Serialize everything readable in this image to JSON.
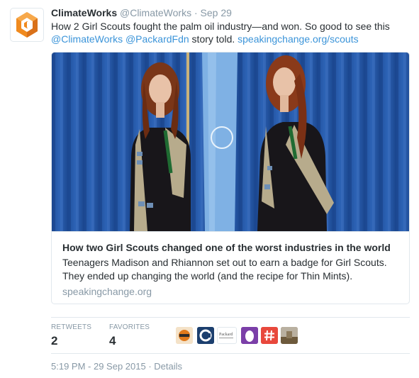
{
  "tweet": {
    "fullname": "ClimateWorks",
    "handle": "@ClimateWorks",
    "separator": "·",
    "date": "Sep 29",
    "text_plain": "How 2 Girl Scouts fought the palm oil industry—and won. So good to see this",
    "mention_1": "@ClimateWorks",
    "mention_2": "@PackardFdn",
    "text_mid": " story told. ",
    "link": "speakingchange.org/scouts"
  },
  "card": {
    "title": "How two Girl Scouts changed one of the worst industries in the world",
    "description": "Teenagers Madison and Rhiannon set out to earn a badge for Girl Scouts. They ended up changing the world (and the recipe for Thin Mints).",
    "domain": "speakingchange.org"
  },
  "stats": {
    "retweets_label": "RETWEETS",
    "retweets_value": "2",
    "favorites_label": "FAVORITES",
    "favorites_value": "4"
  },
  "footer": {
    "timestamp": "5:19 PM - 29 Sep 2015",
    "separator": "·",
    "details": "Details"
  },
  "colors": {
    "link": "#3b94d9",
    "muted": "#8899a6",
    "text": "#292f33",
    "logo_orange": "#f08a1e"
  },
  "icons": {
    "avatar": "climateworks-logo-icon",
    "faces": [
      "lion-avatar-icon",
      "co-logo-icon",
      "packard-logo-icon",
      "egg-avatar-icon",
      "hashtag-avatar-icon",
      "landscape-avatar-icon"
    ]
  }
}
